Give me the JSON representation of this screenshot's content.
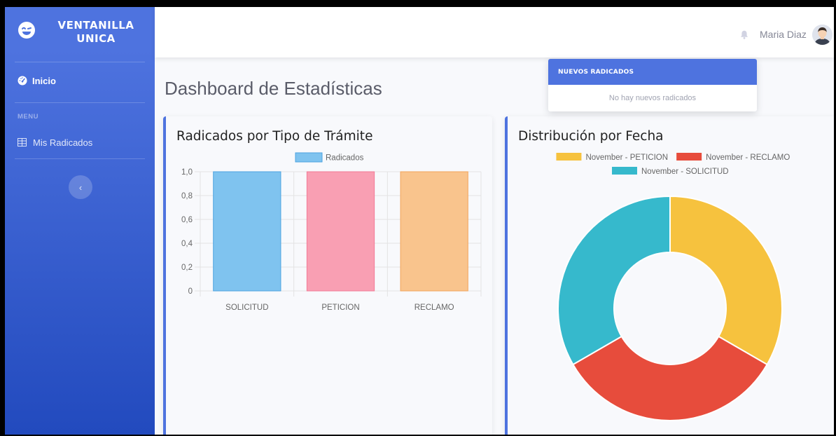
{
  "sidebar": {
    "brand_line1": "VENTANILLA",
    "brand_line2": "UNICA",
    "nav_inicio": "Inicio",
    "heading_menu": "MENU",
    "nav_mis_radicados": "Mis Radicados",
    "toggle_icon": "chevron-left-icon"
  },
  "topbar": {
    "user_name": "Maria Diaz",
    "icons": [
      "bell-icon",
      "avatar"
    ]
  },
  "page": {
    "title": "Dashboard de Estadísticas"
  },
  "alerts": {
    "header": "NUEVOS RADICADOS",
    "empty_text": "No hay nuevos radicados"
  },
  "colors": {
    "primary": "#4e73df",
    "bar_solicitud": "#7fc3ef",
    "bar_peticion": "#f99fb3",
    "bar_reclamo": "#f9c48d",
    "donut_peticion": "#f6c23e",
    "donut_reclamo": "#e74c3c",
    "donut_solicitud": "#36b9cc"
  },
  "chart_data": [
    {
      "type": "bar",
      "title": "Radicados por Tipo de Trámite",
      "categories": [
        "SOLICITUD",
        "PETICION",
        "RECLAMO"
      ],
      "series": [
        {
          "name": "Radicados",
          "values": [
            1,
            1,
            1
          ]
        }
      ],
      "ylim": [
        0,
        1
      ],
      "yticks": [
        "0",
        "0,2",
        "0,4",
        "0,6",
        "0,8",
        "1,0"
      ],
      "legend_position": "top",
      "grid": true
    },
    {
      "type": "pie",
      "title": "Distribución por Fecha",
      "labels": [
        "November - PETICION",
        "November - RECLAMO",
        "November - SOLICITUD"
      ],
      "values": [
        1,
        1,
        1
      ],
      "donut": true,
      "legend_position": "top"
    }
  ]
}
